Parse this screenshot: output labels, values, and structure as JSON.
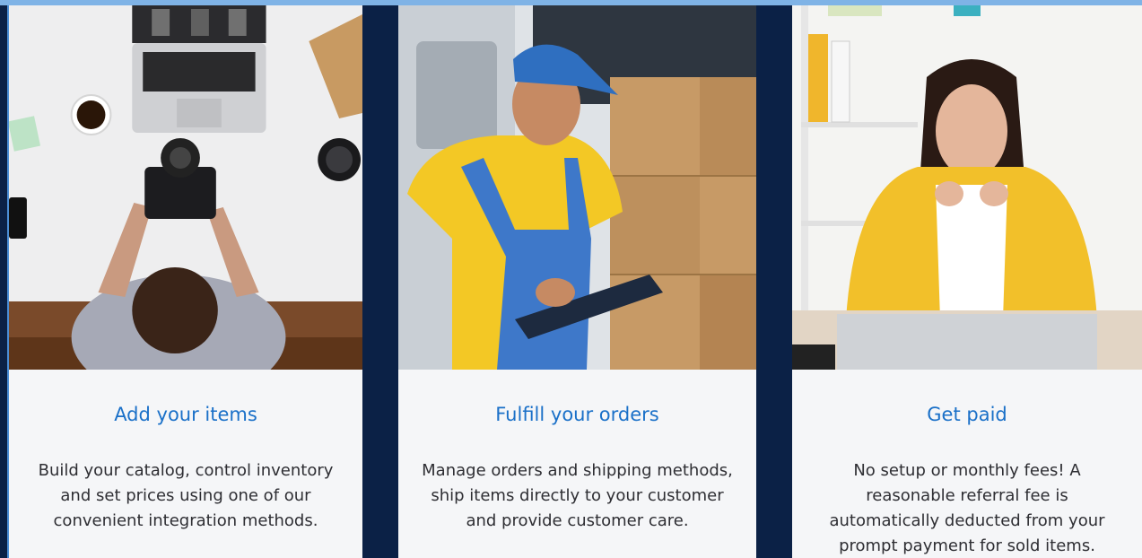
{
  "cards": [
    {
      "image": "person-with-camera-at-desk",
      "title": "Add your items",
      "description": "Build your catalog, control inventory and set prices using one of our convenient integration methods."
    },
    {
      "image": "delivery-worker-with-clipboard",
      "title": "Fulfill your orders",
      "description": "Manage orders and shipping methods, ship items directly to your customer and provide customer care."
    },
    {
      "image": "woman-looking-at-laptop",
      "title": "Get paid",
      "description": "No setup or monthly fees! A reasonable referral fee is automatically deducted from your prompt payment for sold items."
    }
  ],
  "colors": {
    "background": "#0b2146",
    "card": "#f5f6f8",
    "title": "#1a70c8",
    "text": "#2e2e33",
    "accent": "#7fb3e6"
  }
}
